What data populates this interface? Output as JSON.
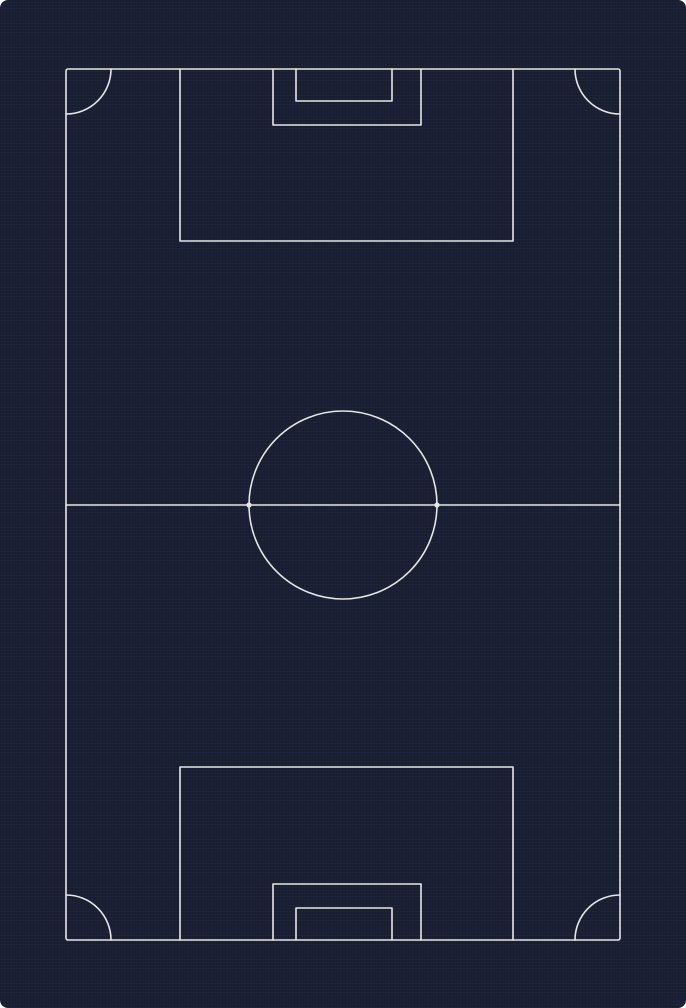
{
  "board": {
    "background_color": "#1a1f33",
    "line_color": "#e6e6e6"
  }
}
